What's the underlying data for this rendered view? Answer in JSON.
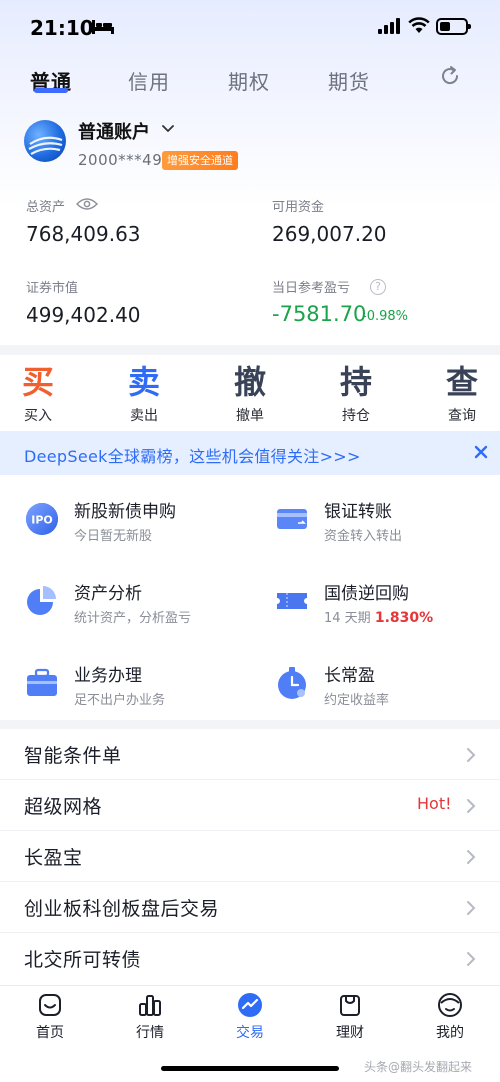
{
  "status_bar": {
    "time": "21:10"
  },
  "tabs": [
    {
      "label": "普通",
      "active": true
    },
    {
      "label": "信用"
    },
    {
      "label": "期权"
    },
    {
      "label": "期货"
    }
  ],
  "account": {
    "name": "普通账户",
    "number": "2000***49",
    "secure_badge": "增强安全通道"
  },
  "summary": {
    "total_assets_label": "总资产",
    "total_assets": "768,409.63",
    "available_funds_label": "可用资金",
    "available_funds": "269,007.20",
    "market_value_label": "证券市值",
    "market_value": "499,402.40",
    "daily_pnl_label": "当日参考盈亏",
    "daily_pnl": "-7581.70",
    "daily_pnl_pct": "-0.98%",
    "pnl_color": "#1aa34a"
  },
  "actions": [
    {
      "glyph": "买",
      "label": "买入",
      "color": "#f0602f"
    },
    {
      "glyph": "卖",
      "label": "卖出",
      "color": "#2f6cf6"
    },
    {
      "glyph": "撤",
      "label": "撤单",
      "color": "#3a4257"
    },
    {
      "glyph": "持",
      "label": "持仓",
      "color": "#3a4257"
    },
    {
      "glyph": "查",
      "label": "查询",
      "color": "#3a4257"
    }
  ],
  "banner": {
    "text": "DeepSeek全球霸榜，这些机会值得关注>>>"
  },
  "services": [
    {
      "title": "新股新债申购",
      "subtitle": "今日暂无新股",
      "icon": "ipo-icon"
    },
    {
      "title": "银证转账",
      "subtitle": "资金转入转出",
      "icon": "card-transfer-icon"
    },
    {
      "title": "资产分析",
      "subtitle": "统计资产，分析盈亏",
      "icon": "pie-chart-icon"
    },
    {
      "title": "国债逆回购",
      "subtitle_prefix": "14 天期",
      "subtitle_rate": "1.830%",
      "icon": "ticket-icon"
    },
    {
      "title": "业务办理",
      "subtitle": "足不出户办业务",
      "icon": "briefcase-icon"
    },
    {
      "title": "长常盈",
      "subtitle": "约定收益率",
      "icon": "clock-bag-icon"
    }
  ],
  "list": [
    {
      "label": "智能条件单",
      "hot": ""
    },
    {
      "label": "超级网格",
      "hot": "Hot!"
    },
    {
      "label": "长盈宝",
      "hot": ""
    },
    {
      "label": "创业板科创板盘后交易",
      "hot": ""
    },
    {
      "label": "北交所可转债",
      "hot": ""
    }
  ],
  "bottom_nav": [
    {
      "label": "首页",
      "icon": "home-icon"
    },
    {
      "label": "行情",
      "icon": "market-icon"
    },
    {
      "label": "交易",
      "icon": "trade-icon",
      "active": true
    },
    {
      "label": "理财",
      "icon": "wealth-icon"
    },
    {
      "label": "我的",
      "icon": "profile-icon"
    }
  ],
  "watermark": "头条@翻头发翻起来"
}
